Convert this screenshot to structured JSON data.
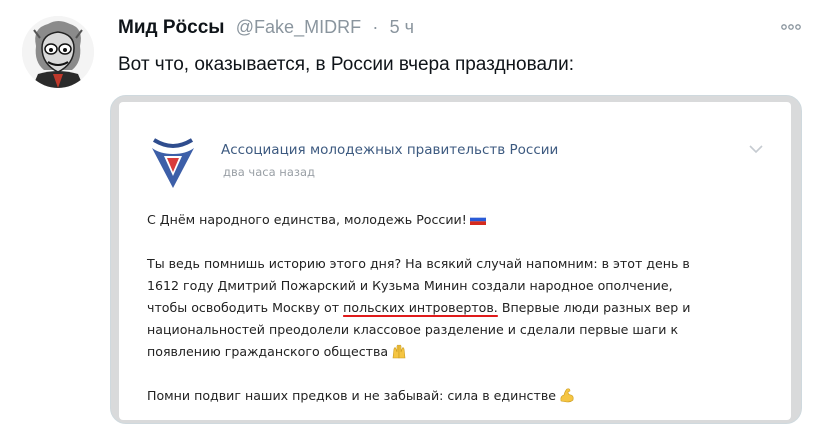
{
  "tweet": {
    "display_name": "Мид Рöссы",
    "handle": "@Fake_MIDRF",
    "separator": "·",
    "time": "5 ч",
    "text": "Вот что, оказывается, в России вчера праздновали:"
  },
  "post": {
    "org_name": "Ассоциация молодежных правительств России",
    "time": "два часа назад",
    "greeting": "С Днём народного единства, молодежь России!",
    "paragraph_line1": "Ты ведь помнишь историю этого дня? На всякий случай напомним: в этот день в",
    "paragraph_line2": "1612 году Дмитрий Пожарский и Кузьма Минин создали народное ополчение,",
    "paragraph_line3_before": "чтобы освободить Москву от",
    "paragraph_line3_highlight": "польских интровертов.",
    "paragraph_line3_after": "Впервые люди разных вер и",
    "paragraph_line4": "национальностей преодолели классовое разделение и сделали первые шаги к",
    "paragraph_line5": "появлению гражданского общества",
    "closing": "Помни подвиг наших предков и не забывай: сила в единстве"
  },
  "icons": {
    "more": "more-icon",
    "chevron": "chevron-down-icon",
    "flag": "russia-flag-icon",
    "hands": "raised-hands-icon",
    "muscle": "flexed-biceps-icon"
  },
  "colors": {
    "link_blue": "#3d5a80",
    "underline_red": "#e01b1b",
    "muted_gray": "#8a959e"
  }
}
